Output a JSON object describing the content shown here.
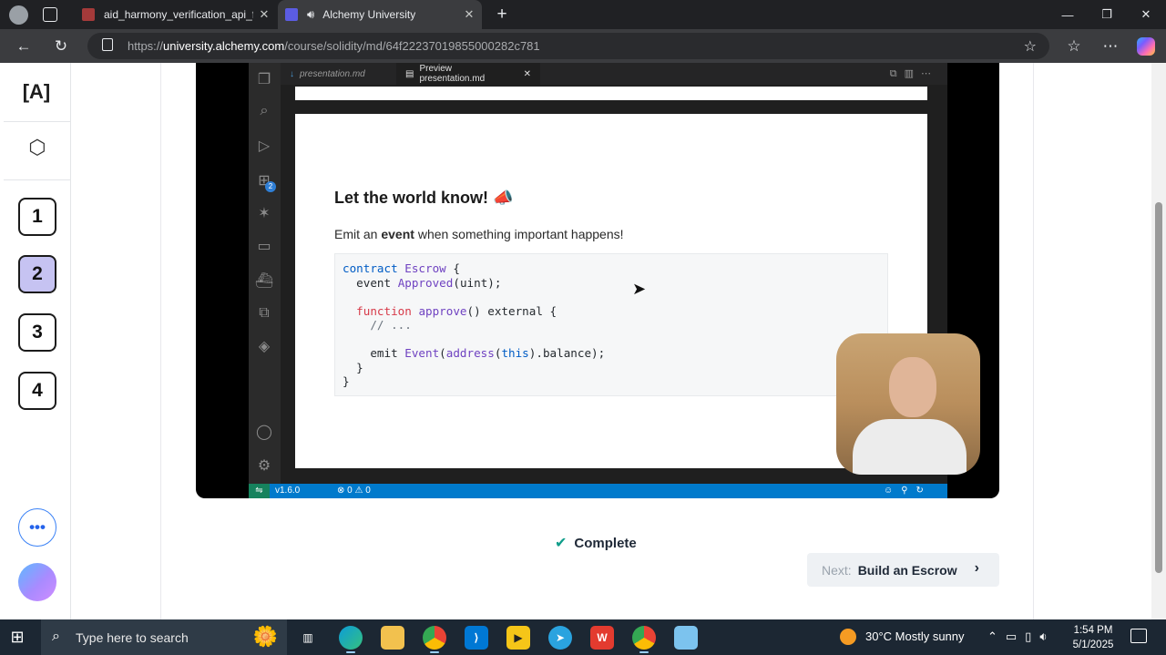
{
  "browser": {
    "tabs": [
      {
        "title": "aid_harmony_verification_api_field",
        "active": false
      },
      {
        "title": "Alchemy University",
        "active": true
      }
    ],
    "url_prefix": "https://",
    "url_host": "university.alchemy.com",
    "url_path": "/course/solidity/md/64f22237019855000282c781"
  },
  "rail": {
    "logo": "[A]",
    "steps": [
      "1",
      "2",
      "3",
      "4"
    ],
    "active_step": "2",
    "more_label": "•••"
  },
  "video": {
    "editor_tabs": [
      "presentation.md",
      "Preview presentation.md"
    ],
    "slide_title": "Let the world know! 📣",
    "slide_text_pre": "Emit an ",
    "slide_text_bold": "event",
    "slide_text_post": " when something important happens!",
    "code_lines": [
      "contract Escrow {",
      "  event Approved(uint);",
      "",
      "  function approve() external {",
      "    // ...",
      "",
      "    emit Event(address(this).balance);",
      "  }",
      "}"
    ],
    "status_version": "v1.6.0",
    "status_problems": "⊗ 0 ⚠ 0"
  },
  "lesson": {
    "complete_label": "Complete",
    "next_prefix": "Next:",
    "next_title": "Build an Escrow"
  },
  "taskbar": {
    "search_placeholder": "Type here to search",
    "weather": "30°C  Mostly sunny",
    "time": "1:54 PM",
    "date": "5/1/2025"
  },
  "colors": {
    "accent_step": "#c6c3f2",
    "complete_check": "#0f9d8a",
    "statusbar": "#007acc"
  }
}
